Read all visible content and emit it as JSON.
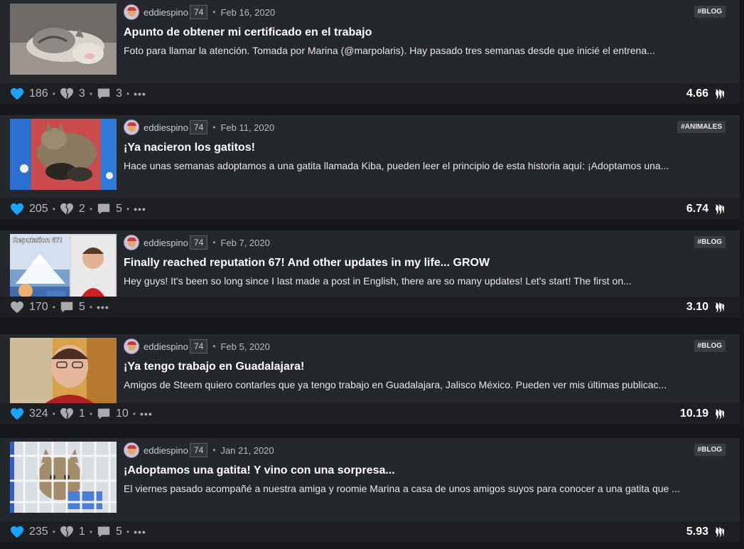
{
  "posts": [
    {
      "author": "eddiespino",
      "reputation": "74",
      "date": "Feb 16, 2020",
      "tag": "#BLOG",
      "title": "Apunto de obtener mi certificado en el trabajo",
      "summary": "Foto para llamar la atención. Tomada por Marina (@marpolaris). Hay pasado tres semanas desde que inicié el entrena...",
      "votes": "186",
      "downvotes": "3",
      "comments": "3",
      "payout": "4.66",
      "image": "sleeping-kitten-photo"
    },
    {
      "author": "eddiespino",
      "reputation": "74",
      "date": "Feb 11, 2020",
      "tag": "#ANIMALES",
      "title": "¡Ya nacieron los gatitos!",
      "summary": "Hace unas semanas adoptamos a una gatita llamada Kiba, pueden leer el principio de esta historia aquí: ¡Adoptamos una...",
      "votes": "205",
      "downvotes": "2",
      "comments": "5",
      "payout": "6.74",
      "image": "cat-with-kittens-photo"
    },
    {
      "author": "eddiespino",
      "reputation": "74",
      "date": "Feb 7, 2020",
      "tag": "#BLOG",
      "title": "Finally reached reputation 67! And other updates in my life... GROW",
      "summary": "Hey guys! It's been so long since I last made a post in English, there are so many updates! Let's start! The first on...",
      "votes": "170",
      "downvotes": null,
      "comments": "5",
      "payout": "3.10",
      "image": "reputation-67-collage",
      "image_text": "Reputation 67!"
    },
    {
      "author": "eddiespino",
      "reputation": "74",
      "date": "Feb 5, 2020",
      "tag": "#BLOG",
      "title": "¡Ya tengo trabajo en Guadalajara!",
      "summary": "Amigos de Steem quiero contarles que ya tengo trabajo en Guadalajara, Jalisco México. Pueden ver mis últimas publicac...",
      "votes": "324",
      "downvotes": "1",
      "comments": "10",
      "payout": "10.19",
      "image": "selfie-photo"
    },
    {
      "author": "eddiespino",
      "reputation": "74",
      "date": "Jan 21, 2020",
      "tag": "#BLOG",
      "title": "¡Adoptamos una gatita! Y vino con una sorpresa...",
      "summary": "El viernes pasado acompañé a nuestra amiga y roomie Marina a casa de unos amigos suyos para conocer a una gatita que ...",
      "votes": "235",
      "downvotes": "1",
      "comments": "5",
      "payout": "5.93",
      "image": "kitten-in-carrier-photo"
    }
  ],
  "icons": {
    "upvote": "heart-icon",
    "downvote": "broken-heart-icon",
    "comments": "comment-icon",
    "more": "ellipsis-icon",
    "payout": "steem-icon"
  },
  "colors": {
    "upvote_active": "#1aa3ff",
    "upvote_inactive": "#a7aaae",
    "card_bg": "#24272b",
    "footer_bg": "#1d1f23",
    "page_bg": "#16181c"
  },
  "more_label": "•••",
  "separator": "•"
}
